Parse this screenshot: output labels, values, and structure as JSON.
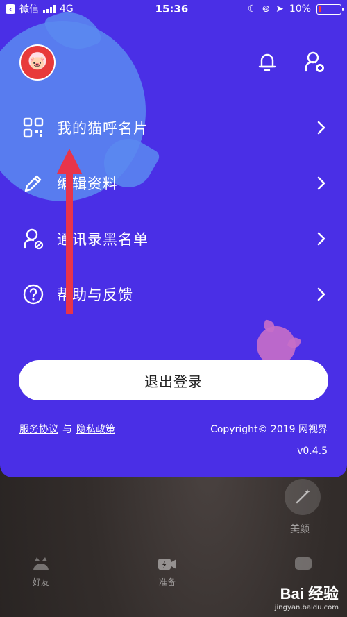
{
  "status_bar": {
    "back_app": "微信",
    "network": "4G",
    "time": "15:36",
    "battery": "10%",
    "battery_level": 0.1
  },
  "profile": {
    "avatar_alt": "pig-avatar"
  },
  "header_icons": [
    "bell-icon",
    "add-user-icon"
  ],
  "menu": [
    {
      "label": "我的猫呼名片",
      "icon": "qr-code-icon"
    },
    {
      "label": "编辑资料",
      "icon": "pencil-icon"
    },
    {
      "label": "通讯录黑名单",
      "icon": "contact-block-icon"
    },
    {
      "label": "帮助与反馈",
      "icon": "help-icon"
    }
  ],
  "logout_label": "退出登录",
  "footer": {
    "terms": "服务协议",
    "and": "与",
    "privacy": "隐私政策",
    "copyright": "Copyright© 2019 网视界",
    "version": "v0.4.5"
  },
  "bottom": {
    "beauty_label": "美颜",
    "tab_friends": "好友",
    "tab_ready": "准备"
  },
  "watermark": {
    "brand": "Bai 经验",
    "url": "jingyan.baidu.com"
  },
  "colors": {
    "panel": "#4a2fe6",
    "blob": "#5a8af0",
    "arrow": "#e8344a"
  }
}
